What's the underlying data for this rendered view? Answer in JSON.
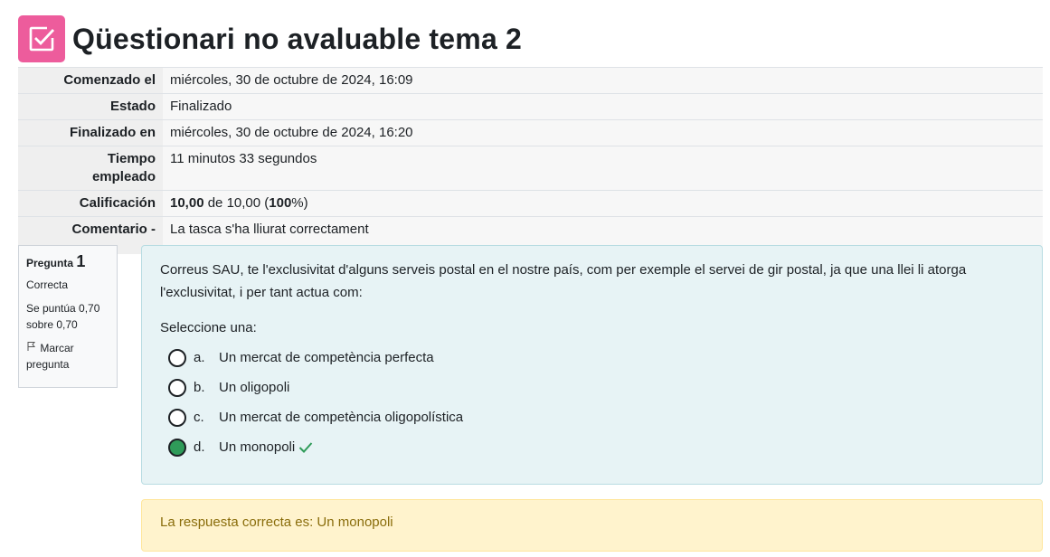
{
  "header": {
    "title": "Qüestionari no avaluable tema 2",
    "icon": "checkbox-icon",
    "icon_color": "#ed5c9c"
  },
  "summary": {
    "started_label": "Comenzado el",
    "started_value": "miércoles, 30 de octubre de 2024, 16:09",
    "state_label": "Estado",
    "state_value": "Finalizado",
    "finished_label": "Finalizado en",
    "finished_value": "miércoles, 30 de octubre de 2024, 16:20",
    "time_label_1": "Tiempo",
    "time_label_2": "empleado",
    "time_value": "11 minutos 33 segundos",
    "grade_label": "Calificación",
    "grade_score": "10,00",
    "grade_of": " de 10,00 (",
    "grade_percent": "100",
    "grade_tail": "%)",
    "comment_label": "Comentario -",
    "comment_value": "La tasca s'ha lliurat correctament"
  },
  "question_info": {
    "label": "Pregunta",
    "number": "1",
    "state": "Correcta",
    "grade": "Se puntúa 0,70 sobre 0,70",
    "flag_label": "Marcar pregunta",
    "flag_icon": "flag-icon"
  },
  "question": {
    "text": "Correus SAU, te l'exclusivitat d'alguns serveis postal en el nostre país, com per exemple el servei de gir postal, ja que una llei li atorga l'exclusivitat, i per tant actua com:",
    "prompt": "Seleccione una:",
    "answers": [
      {
        "letter": "a.",
        "text": "Un mercat de competència perfecta",
        "selected": false
      },
      {
        "letter": "b.",
        "text": "Un oligopoli",
        "selected": false
      },
      {
        "letter": "c.",
        "text": "Un mercat de competència oligopolística",
        "selected": false
      },
      {
        "letter": "d.",
        "text": "Un monopoli",
        "selected": true
      }
    ],
    "correct_icon": "check-icon",
    "correct_color": "#2f9b59"
  },
  "feedback": {
    "text": "La respuesta correcta es: Un monopoli"
  }
}
